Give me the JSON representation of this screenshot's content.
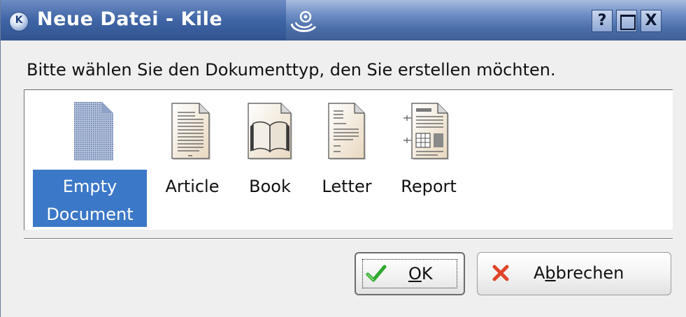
{
  "window": {
    "title": "Neue Datei - Kile",
    "app_icon_letter": "K",
    "buttons": {
      "help": "?",
      "maximize": "",
      "close": "X"
    }
  },
  "dialog": {
    "prompt": "Bitte wählen Sie den Dokumenttyp, den Sie erstellen möchten.",
    "document_types": [
      {
        "label_line1": "Empty",
        "label_line2": "Document",
        "selected": true,
        "icon": "blank-document-icon"
      },
      {
        "label_line1": "Article",
        "selected": false,
        "icon": "article-document-icon"
      },
      {
        "label_line1": "Book",
        "selected": false,
        "icon": "book-document-icon"
      },
      {
        "label_line1": "Letter",
        "selected": false,
        "icon": "letter-document-icon"
      },
      {
        "label_line1": "Report",
        "selected": false,
        "icon": "report-document-icon"
      }
    ],
    "ok_button": {
      "label_pre": "",
      "label_mnemonic": "O",
      "label_post": "K",
      "icon": "checkmark-icon",
      "default": true
    },
    "cancel_button": {
      "label_pre": "A",
      "label_mnemonic": "b",
      "label_post": "brechen",
      "icon": "cancel-x-icon"
    }
  },
  "colors": {
    "selection": "#3c78c8",
    "titlebar": "#4b6ea8",
    "ok_check": "#2fa82f",
    "cancel_x": "#e0452a"
  }
}
